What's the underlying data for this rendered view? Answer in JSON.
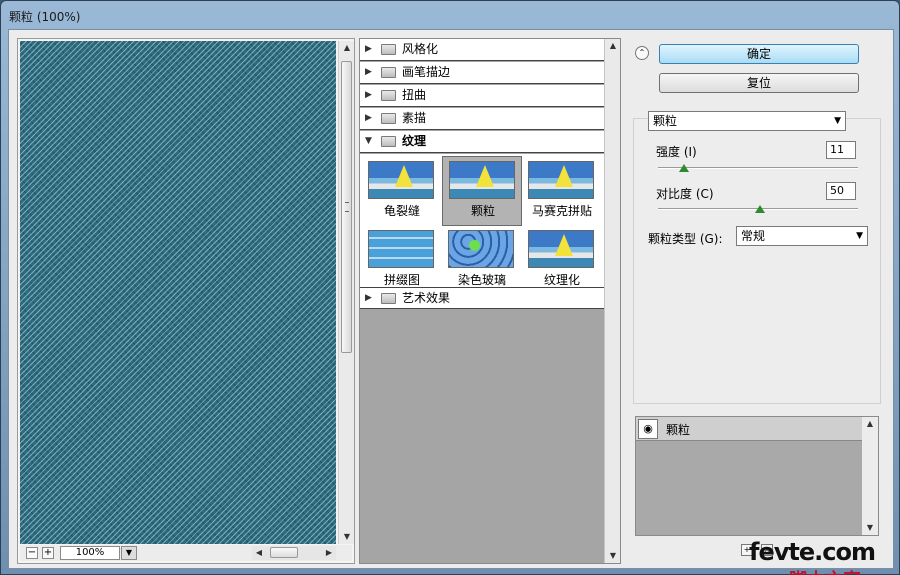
{
  "window": {
    "title": "颗粒 (100%)"
  },
  "preview": {
    "zoom": "100%",
    "zoom_out": "−",
    "zoom_in": "+"
  },
  "gallery": {
    "categories": [
      {
        "label": "风格化",
        "expanded": false
      },
      {
        "label": "画笔描边",
        "expanded": false
      },
      {
        "label": "扭曲",
        "expanded": false
      },
      {
        "label": "素描",
        "expanded": false
      },
      {
        "label": "纹理",
        "expanded": true
      },
      {
        "label": "艺术效果",
        "expanded": false
      }
    ],
    "texture_filters": [
      {
        "label": "龟裂缝",
        "selected": false
      },
      {
        "label": "颗粒",
        "selected": true
      },
      {
        "label": "马赛克拼贴",
        "selected": false
      },
      {
        "label": "拼缀图",
        "selected": false
      },
      {
        "label": "染色玻璃",
        "selected": false
      },
      {
        "label": "纹理化",
        "selected": false
      }
    ]
  },
  "buttons": {
    "ok": "确定",
    "reset": "复位"
  },
  "settings": {
    "filter_select": "颗粒",
    "intensity": {
      "label": "强度 (I)",
      "value": "11",
      "level": 11
    },
    "contrast": {
      "label": "对比度 (C)",
      "value": "50",
      "level": 50
    },
    "grain_type": {
      "label": "颗粒类型 (G):",
      "value": "常规"
    }
  },
  "layers": {
    "items": [
      {
        "label": "颗粒",
        "visible": true
      }
    ]
  },
  "watermark": {
    "line1": "fevte.com",
    "line2": "脚本之家"
  },
  "colors": {
    "accent": "#a9dcf5",
    "slider_knob": "#2d8b2d"
  }
}
